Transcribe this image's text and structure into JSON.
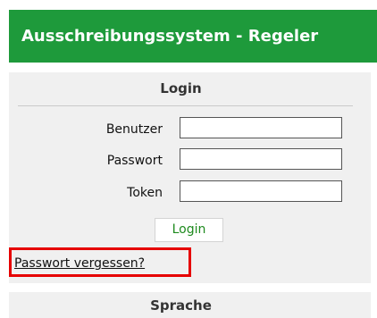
{
  "header": {
    "title": "Ausschreibungssystem - Regeler"
  },
  "login": {
    "title": "Login",
    "fields": [
      {
        "label": "Benutzer",
        "value": ""
      },
      {
        "label": "Passwort",
        "value": ""
      },
      {
        "label": "Token",
        "value": ""
      }
    ],
    "button_label": "Login",
    "forgot_link": "Passwort vergessen?"
  },
  "sprache": {
    "title": "Sprache"
  },
  "colors": {
    "banner": "#1e9a3b",
    "panel_bg": "#f0f0f0",
    "button_text": "#1e8a1e",
    "highlight": "#e60000"
  }
}
